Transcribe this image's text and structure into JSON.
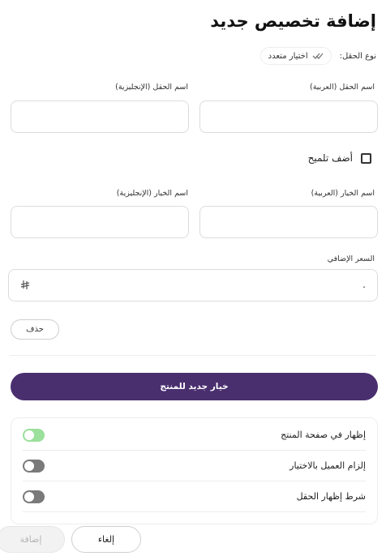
{
  "title": "إضافة تخصيص جديد",
  "field_type": {
    "label": "نوع الحقل:",
    "value": "اختيار متعدد",
    "icon": "double-check-icon"
  },
  "field_name": {
    "arabic_label": "اسم الحقل (العربية)",
    "english_label": "اسم الحقل (الإنجليزية)",
    "arabic_value": "",
    "english_value": ""
  },
  "hint": {
    "label": "أضف تلميح",
    "checked": false
  },
  "option_name": {
    "arabic_label": "اسم الخيار (العربية)",
    "english_label": "اسم الخيار (الإنجليزية)",
    "arabic_value": "",
    "english_value": ""
  },
  "extra_price": {
    "label": "السعر الإضافي",
    "value": ".",
    "currency_icon": "riyal-icon"
  },
  "delete_label": "حذف",
  "new_option_label": "خيار جديد للمنتج",
  "toggles": [
    {
      "label": "إظهار في صفحة المنتج",
      "on": true
    },
    {
      "label": "إلزام العميل بالاختيار",
      "on": false
    },
    {
      "label": "شرط إظهار الحقل",
      "on": false
    }
  ],
  "footer": {
    "cancel_label": "إلغاء",
    "add_label": "إضافة"
  },
  "colors": {
    "primary": "#4a2f6f",
    "toggle_on": "#9be09b",
    "toggle_off": "#7a7a7a"
  }
}
